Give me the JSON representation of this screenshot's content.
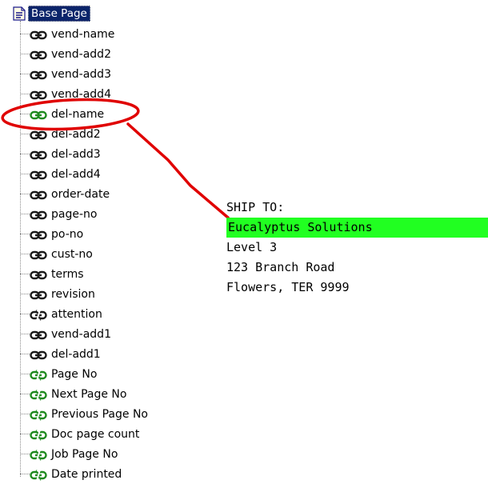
{
  "tree": {
    "root_label": "Base Page",
    "items": [
      {
        "label": "vend-name",
        "icon": "link-icon"
      },
      {
        "label": "vend-add2",
        "icon": "link-icon"
      },
      {
        "label": "vend-add3",
        "icon": "link-icon"
      },
      {
        "label": "vend-add4",
        "icon": "link-icon"
      },
      {
        "label": "del-name",
        "icon": "link-icon-green"
      },
      {
        "label": "del-add2",
        "icon": "link-icon"
      },
      {
        "label": "del-add3",
        "icon": "link-icon"
      },
      {
        "label": "del-add4",
        "icon": "link-icon"
      },
      {
        "label": "order-date",
        "icon": "link-icon"
      },
      {
        "label": "page-no",
        "icon": "link-icon"
      },
      {
        "label": "po-no",
        "icon": "link-icon"
      },
      {
        "label": "cust-no",
        "icon": "link-icon"
      },
      {
        "label": "terms",
        "icon": "link-icon"
      },
      {
        "label": "revision",
        "icon": "link-icon"
      },
      {
        "label": "attention",
        "icon": "broken-link-icon"
      },
      {
        "label": "vend-add1",
        "icon": "link-icon"
      },
      {
        "label": "del-add1",
        "icon": "link-icon"
      },
      {
        "label": "Page No",
        "icon": "broken-link-icon-green"
      },
      {
        "label": "Next Page No",
        "icon": "broken-link-icon-green"
      },
      {
        "label": "Previous Page No",
        "icon": "broken-link-icon-green"
      },
      {
        "label": "Doc page count",
        "icon": "broken-link-icon-green"
      },
      {
        "label": "Job Page No",
        "icon": "broken-link-icon-green"
      },
      {
        "label": "Date printed",
        "icon": "broken-link-icon-green"
      }
    ]
  },
  "address": {
    "lines": [
      {
        "text": "SHIP TO:",
        "highlighted": false
      },
      {
        "text": "Eucalyptus Solutions",
        "highlighted": true
      },
      {
        "text": "Level 3",
        "highlighted": false
      },
      {
        "text": "123 Branch Road",
        "highlighted": false
      },
      {
        "text": "Flowers, TER 9999",
        "highlighted": false
      }
    ]
  },
  "colors": {
    "selection": "#0a246a",
    "highlight": "#21ff21",
    "annotation": "#e00000"
  }
}
